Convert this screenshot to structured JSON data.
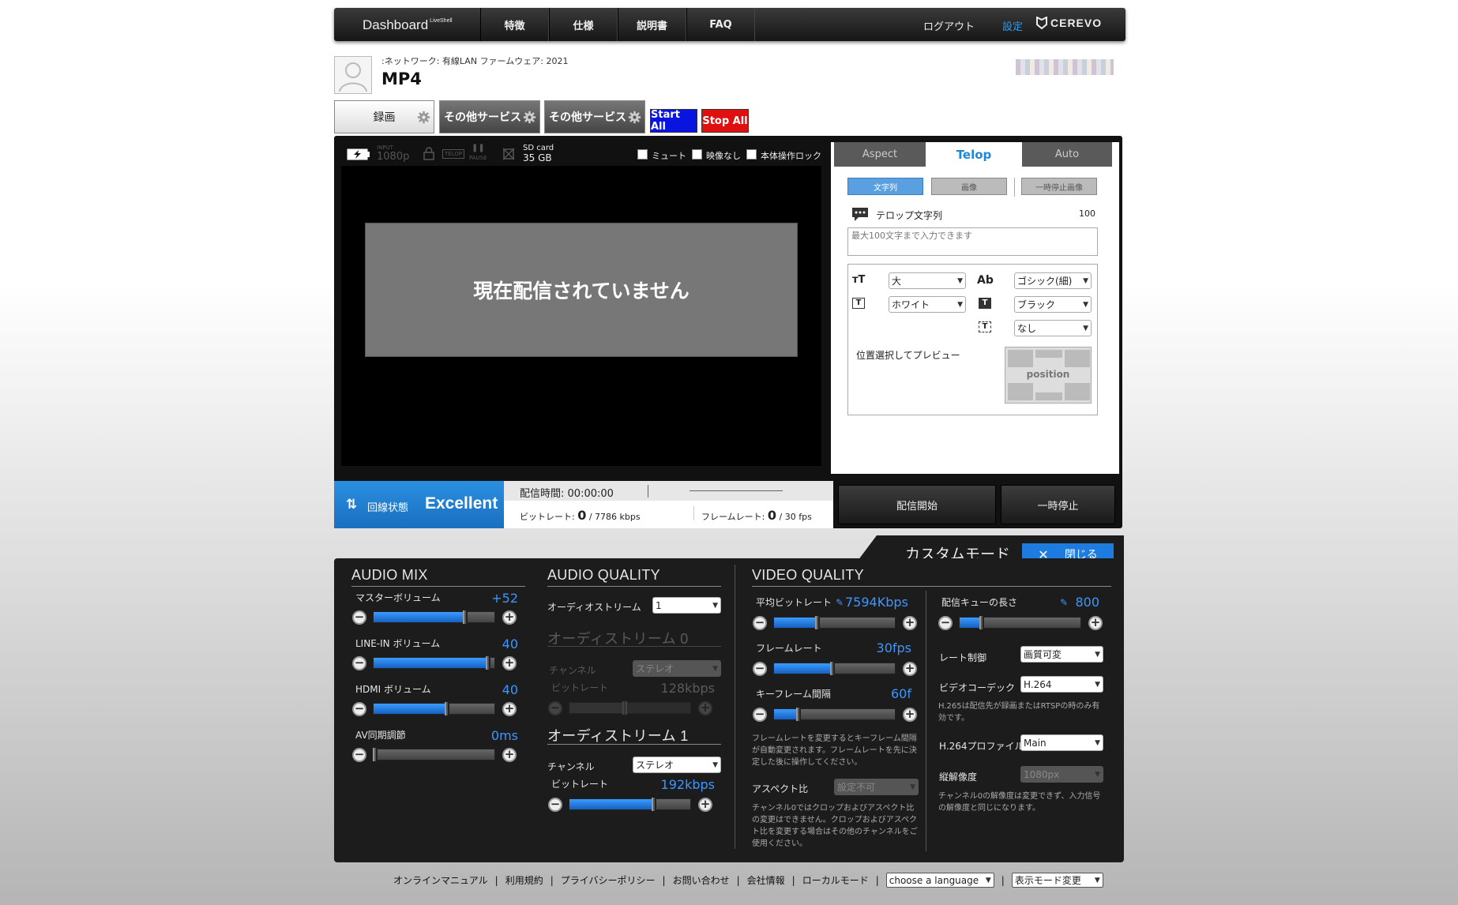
{
  "nav": {
    "brand": "Dashboard",
    "brand_sup": "LiveShell",
    "tabs": [
      "特徴",
      "仕様",
      "説明書",
      "FAQ"
    ],
    "logout": "ログアウト",
    "settings": "設定",
    "logo": "CEREVO"
  },
  "device": {
    "network_label": ":ネットワーク:",
    "network_value": "有線LAN",
    "firmware_label": "ファームウェア:",
    "firmware_value": "2021",
    "name": "MP4"
  },
  "services": {
    "record": "録画",
    "other1": "その他サービス",
    "other2": "その他サービス",
    "start_all": "Start All",
    "stop_all": "Stop All"
  },
  "video_bar": {
    "input_label": "INPUT",
    "input_value": "1080p",
    "telop": "TELOP",
    "pause": "PAUSE",
    "sd_label": "SD card",
    "sd_value": "35 GB",
    "mute": "ミュート",
    "no_video": "映像なし",
    "lock": "本体操作ロック"
  },
  "video": {
    "no_stream": "現在配信されていません"
  },
  "panel": {
    "tabs": [
      "Aspect",
      "Telop",
      "Auto"
    ],
    "subtabs": [
      "文字列",
      "画像",
      "一時停止画像"
    ],
    "telop_label": "テロップ文字列",
    "telop_count": "100",
    "telop_placeholder": "最大100文字まで入力できます",
    "size": "大",
    "font": "ゴシック(細)",
    "color": "ホワイト",
    "bg": "ブラック",
    "border": "なし",
    "preview_label": "位置選択してプレビュー",
    "position": "position"
  },
  "status": {
    "line_label": "回線状態",
    "quality": "Excellent",
    "time_label": "配信時間:",
    "time_value": "00:00:00",
    "bitrate_label": "ビットレート:",
    "bitrate_value": "0",
    "bitrate_max": "/ 7786 kbps",
    "fps_label": "フレームレート:",
    "fps_value": "0",
    "fps_max": "/ 30 fps",
    "start": "配信開始",
    "pause": "一時停止"
  },
  "custom": {
    "title": "カスタムモード",
    "close": "閉じる",
    "audio_mix": {
      "title": "AUDIO MIX",
      "items": [
        {
          "label": "マスターボリューム",
          "value": "+52",
          "level": 0.78
        },
        {
          "label": "LINE-IN ボリューム",
          "value": "40",
          "level": 0.97
        },
        {
          "label": "HDMI ボリューム",
          "value": "40",
          "level": 0.63
        },
        {
          "label": "AV同期調節",
          "value": "0ms",
          "level": 0.03
        }
      ]
    },
    "audio_quality": {
      "title": "AUDIO QUALITY",
      "stream_label": "オーディオストリーム",
      "stream_value": "1",
      "s0_title": "オーディストリーム 0",
      "channel_label": "チャンネル",
      "channel_value": "ステレオ",
      "bitrate_label": "ビットレート",
      "s0_bitrate": "128kbps",
      "s0_level": 0.48,
      "s1_title": "オーディストリーム 1",
      "s1_channel": "ステレオ",
      "s1_bitrate": "192kbps",
      "s1_level": 0.72
    },
    "video_quality": {
      "title": "VIDEO QUALITY",
      "avg_bitrate_label": "平均ビットレート",
      "avg_bitrate_value": "7594Kbps",
      "avg_level": 0.38,
      "framerate_label": "フレームレート",
      "framerate_value": "30fps",
      "fr_level": 0.5,
      "keyframe_label": "キーフレーム間隔",
      "keyframe_value": "60f",
      "kf_level": 0.22,
      "note1": "フレームレートを変更するとキーフレーム間隔が自動変更されます。フレームレートを先に決定した後に操作してください。",
      "aspect_label": "アスペクト比",
      "aspect_value": "設定不可",
      "note2": "チャンネル0ではクロップおよびアスペクト比の変更はできません。クロップおよびアスペクト比を変更する場合はその他のチャンネルをご使用ください。",
      "queue_label": "配信キューの長さ",
      "queue_value": "800",
      "queue_level": 0.2,
      "rate_label": "レート制御",
      "rate_value": "画質可変",
      "codec_label": "ビデオコーデック",
      "codec_value": "H.264",
      "note3": "H.265は配信先が録画またはRTSPの時のみ有効です。",
      "profile_label": "H.264プロファイル",
      "profile_value": "Main",
      "res_label": "縦解像度",
      "res_value": "1080px",
      "note4": "チャンネル0の解像度は変更できず、入力信号の解像度と同じになります。"
    }
  },
  "footer": {
    "links": [
      "オンラインマニュアル",
      "利用規約",
      "プライバシーポリシー",
      "お問い合わせ",
      "会社情報",
      "ローカルモード"
    ],
    "language": "choose a language",
    "display_mode": "表示モード変更"
  },
  "colors": {
    "accent": "#1e88d6",
    "start_all": "#0a14e0",
    "stop_all": "#e01010",
    "value_blue": "#3d96ff"
  }
}
